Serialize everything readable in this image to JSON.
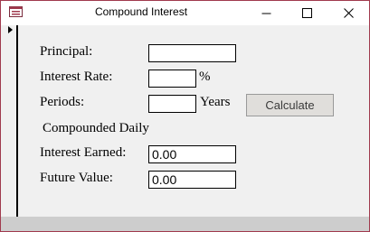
{
  "window": {
    "title": "Compound Interest"
  },
  "icons": {
    "app": "form-icon",
    "minimize": "minimize-icon",
    "maximize": "maximize-icon",
    "close": "close-icon",
    "record": "record-selector-arrow-icon"
  },
  "form": {
    "principal_label": "Principal:",
    "principal_value": "",
    "rate_label": "Interest Rate:",
    "rate_value": "",
    "rate_unit": "%",
    "periods_label": "Periods:",
    "periods_value": "",
    "periods_unit": "Years",
    "calculate_label": "Calculate",
    "compounding_label": "Compounded Daily",
    "interest_label": "Interest Earned:",
    "interest_value": "0.00",
    "future_label": "Future Value:",
    "future_value": "0.00"
  },
  "colors": {
    "window_border": "#a03a4e",
    "form_background": "#f0f0f0",
    "button_face": "#e0dedb",
    "status_bar": "#cdcdcd"
  }
}
